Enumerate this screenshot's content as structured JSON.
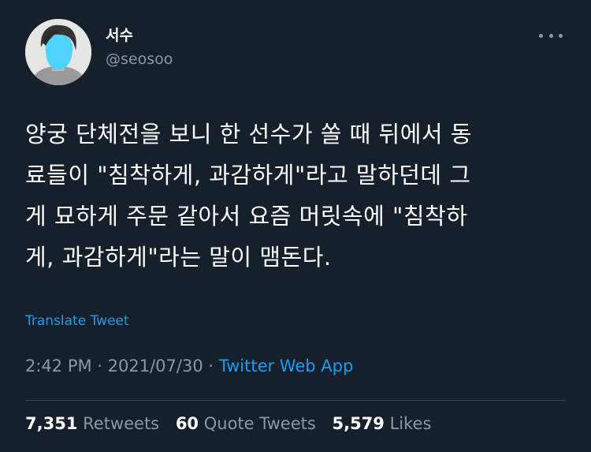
{
  "user": {
    "display_name": "서수",
    "handle": "@seosoo"
  },
  "tweet": {
    "text": "양궁 단체전을 보니 한 선수가 쏠 때 뒤에서 동\n료들이 \"침착하게, 과감하게\"라고 말하던데 그\n게 묘하게 주문 같아서 요즘 머릿속에 \"침착하\n게, 과감하게\"라는 말이 맴돈다.",
    "translate_label": "Translate Tweet"
  },
  "meta": {
    "time": "2:42 PM",
    "date": "2021/07/30",
    "separator": " · ",
    "source": "Twitter Web App"
  },
  "stats": {
    "retweets_count": "7,351",
    "retweets_label": "Retweets",
    "quotes_count": "60",
    "quotes_label": "Quote Tweets",
    "likes_count": "5,579",
    "likes_label": "Likes"
  },
  "colors": {
    "background": "#15202b",
    "link": "#1d9bf0",
    "secondary_text": "#8899a6",
    "divider": "#38444d"
  }
}
